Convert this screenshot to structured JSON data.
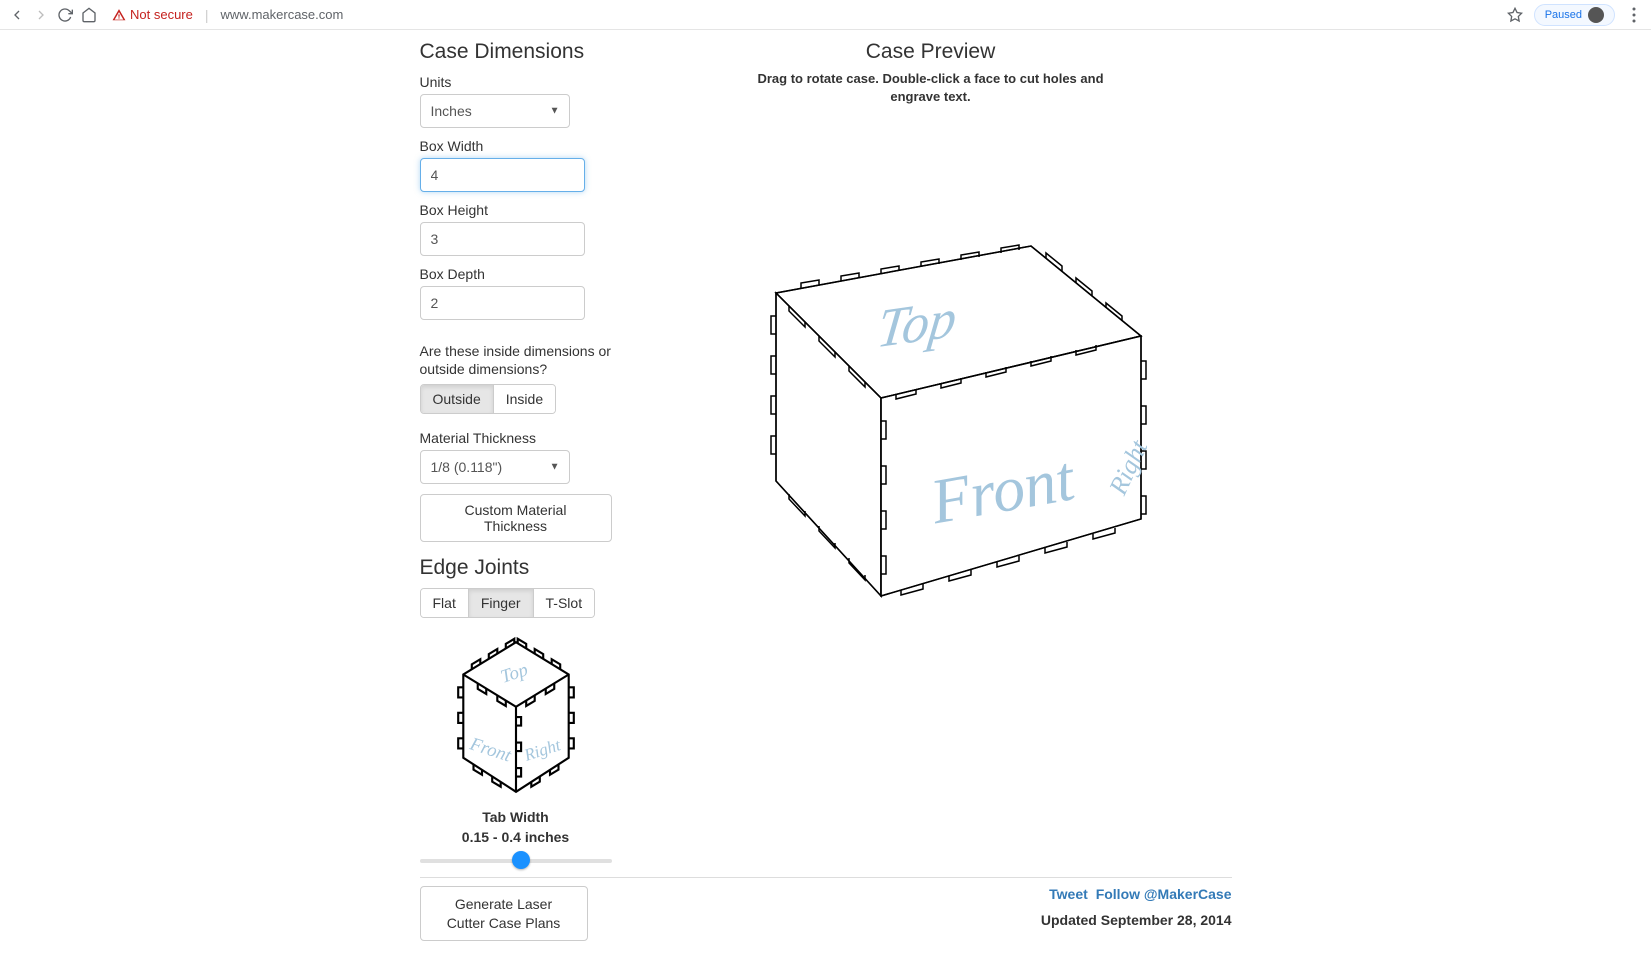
{
  "browser": {
    "not_secure": "Not secure",
    "url": "www.makercase.com",
    "paused": "Paused"
  },
  "dimensions": {
    "title": "Case Dimensions",
    "units_label": "Units",
    "units_value": "Inches",
    "width_label": "Box Width",
    "width_value": "4",
    "height_label": "Box Height",
    "height_value": "3",
    "depth_label": "Box Depth",
    "depth_value": "2",
    "inside_outside_question": "Are these inside dimensions or outside dimensions?",
    "outside_label": "Outside",
    "inside_label": "Inside",
    "thickness_label": "Material Thickness",
    "thickness_value": "1/8 (0.118\")",
    "custom_thickness_btn": "Custom Material Thickness"
  },
  "edge_joints": {
    "title": "Edge Joints",
    "flat": "Flat",
    "finger": "Finger",
    "tslot": "T-Slot",
    "tab_width_label": "Tab Width",
    "tab_range": "0.15 - 0.4 inches",
    "slider_pct": 48
  },
  "preview": {
    "title": "Case Preview",
    "hint": "Drag to rotate case. Double-click a face to cut holes and engrave text.",
    "labels": {
      "top": "Top",
      "front": "Front",
      "right": "Right"
    }
  },
  "footer": {
    "generate_btn": "Generate Laser Cutter Case Plans",
    "tweet": "Tweet",
    "follow": "Follow @MakerCase",
    "updated": "Updated September 28, 2014"
  }
}
